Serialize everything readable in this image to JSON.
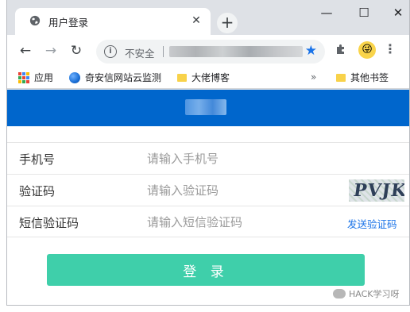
{
  "browser": {
    "tab_title": "用户登录",
    "tab_close": "✕",
    "new_tab": "+",
    "insecure_label": "不安全",
    "window_buttons": {
      "minimize": "—",
      "maximize": "☐",
      "close": "✕"
    },
    "nav": {
      "back": "←",
      "forward": "→",
      "reload": "↻"
    },
    "bookmarks": [
      {
        "label": "应用"
      },
      {
        "label": "奇安信网站云监测"
      },
      {
        "label": "大佬博客"
      }
    ],
    "bookmarks_more": "»",
    "other_bookmarks": "其他书签"
  },
  "form": {
    "phone_label": "手机号",
    "phone_placeholder": "请输入手机号",
    "captcha_label": "验证码",
    "captcha_placeholder": "请输入验证码",
    "captcha_image_text": "PVJK",
    "sms_label": "短信验证码",
    "sms_placeholder": "请输入短信验证码",
    "send_code": "发送验证码",
    "login_button": "登 录"
  },
  "watermark": "HACK学习呀",
  "colors": {
    "header": "#0066cc",
    "login_button": "#3fcfaa",
    "link": "#1a73e8"
  }
}
